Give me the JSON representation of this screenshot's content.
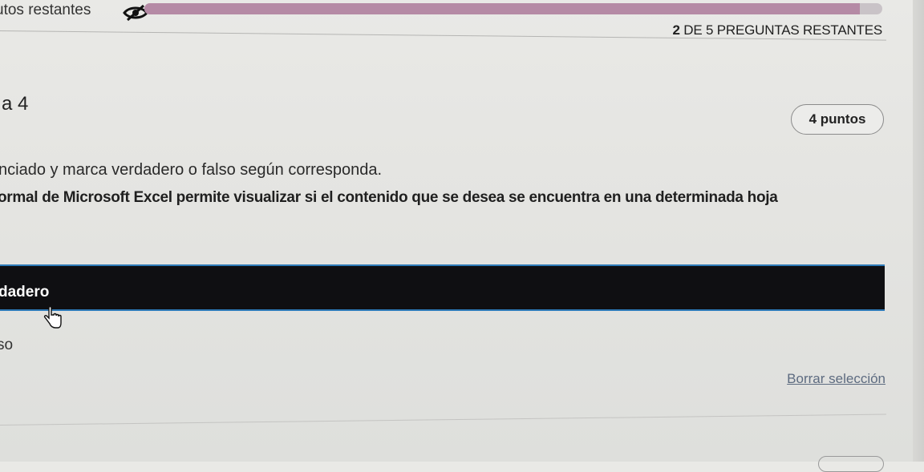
{
  "header": {
    "timer_label": "utos restantes",
    "progress_percent": 97,
    "remaining_bold": "2",
    "remaining_text": " DE 5 PREGUNTAS RESTANTES",
    "hide_icon": "eye-slash-icon"
  },
  "question": {
    "number_label": "a 4",
    "points": "4 puntos",
    "instruction": "nciado y marca verdadero o falso según corresponda.",
    "statement": "ormal de Microsoft Excel permite visualizar si el contenido que se desea se encuentra en una determinada hoja"
  },
  "options": [
    {
      "label": "dadero",
      "selected": true
    },
    {
      "label": "so",
      "selected": false
    }
  ],
  "actions": {
    "clear_label": "Borrar selección"
  },
  "colors": {
    "selected_bg": "#0f0f12",
    "selected_border": "#2d7ab8",
    "progress_fill": "#b58aa5",
    "link": "#5d6b80"
  }
}
